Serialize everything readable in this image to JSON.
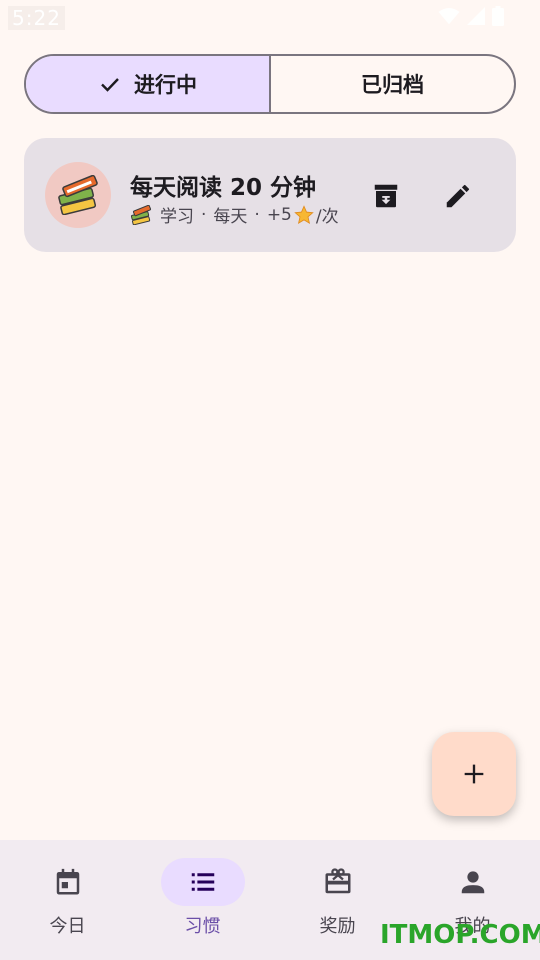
{
  "status_bar": {
    "time": "5:22",
    "icons": [
      "wifi-icon",
      "signal-icon",
      "battery-icon"
    ]
  },
  "filter": {
    "active_label": "进行中",
    "archived_label": "已归档",
    "selected": "active"
  },
  "habits": [
    {
      "emoji_icon": "books-icon",
      "title": "每天阅读 20 分钟",
      "category": "学习",
      "frequency": "每天",
      "reward_prefix": "+5",
      "reward_suffix": "/次",
      "separator": "·"
    }
  ],
  "fab": {
    "icon": "plus-icon"
  },
  "bottom_nav": {
    "items": [
      {
        "label": "今日",
        "icon": "calendar-icon"
      },
      {
        "label": "习惯",
        "icon": "list-icon"
      },
      {
        "label": "奖励",
        "icon": "gift-card-icon"
      },
      {
        "label": "我的",
        "icon": "person-icon"
      }
    ],
    "selected_index": 1
  },
  "watermark": "ITMOP.COM",
  "colors": {
    "background": "#fff7f3",
    "accent": "#6b4fa8",
    "accent_container": "#e9dcff",
    "card": "#e6e0e6",
    "fab": "#ffdbca",
    "nav_bar": "#f2ebf1",
    "watermark": "#2aa52a"
  }
}
